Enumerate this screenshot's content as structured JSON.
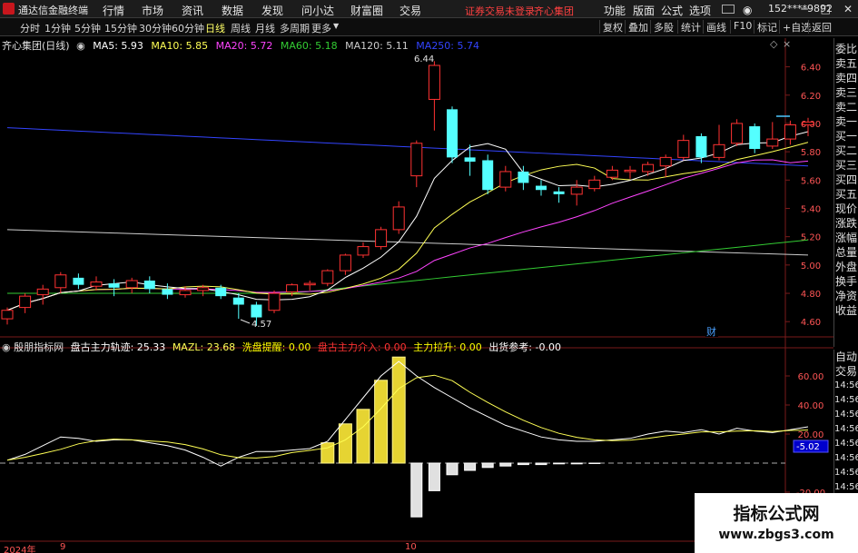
{
  "menubar": {
    "app_title": "通达信金融终端",
    "menus": [
      "行情",
      "市场",
      "资讯",
      "数据",
      "发现",
      "问小达",
      "财富圈",
      "交易"
    ],
    "trade_status": "证券交易未登录",
    "stock_name_red": "齐心集团",
    "right_menus": [
      "功能",
      "版面",
      "公式",
      "选项"
    ],
    "account": "152****9892",
    "window_controls": [
      "─",
      "□",
      "✕"
    ]
  },
  "toolbar": {
    "timeframes": [
      "分时",
      "1分钟",
      "5分钟",
      "15分钟",
      "30分钟",
      "60分钟",
      "日线",
      "周线",
      "月线",
      "多周期",
      "更多"
    ],
    "active_timeframe": "日线",
    "right_buttons": [
      "复权",
      "叠加",
      "多股",
      "统计",
      "画线",
      "F10",
      "标记",
      "+自选",
      "返回"
    ]
  },
  "main_chart": {
    "title": "齐心集团(日线)",
    "ma_labels": [
      {
        "text": "MA5: 5.93",
        "color": "#ffffff"
      },
      {
        "text": "MA10: 5.85",
        "color": "#ffff55"
      },
      {
        "text": "MA20: 5.72",
        "color": "#ff44ff"
      },
      {
        "text": "MA60: 5.18",
        "color": "#33cc33"
      },
      {
        "text": "MA120: 5.11",
        "color": "#cccccc"
      },
      {
        "text": "MA250: 5.74",
        "color": "#3344ff"
      }
    ],
    "high_label": "6.44",
    "low_label": "4.57",
    "cai_label": "财",
    "price_ticks": [
      "6.40",
      "6.20",
      "6.00",
      "5.80",
      "5.60",
      "5.40",
      "5.20",
      "5.00",
      "4.80",
      "4.60"
    ]
  },
  "right_panel": {
    "items": [
      "委比",
      "卖五",
      "卖四",
      "卖三",
      "卖二",
      "卖一",
      "买一",
      "买二",
      "买三",
      "买四",
      "买五",
      "现价",
      "涨跌",
      "涨幅",
      "总量",
      "外盘",
      "换手",
      "净资",
      "收益"
    ],
    "lower_items": [
      "自动",
      "交易",
      "14:56",
      "14:56",
      "14:56",
      "14:56",
      "14:56",
      "14:56",
      "14:56",
      "14:56"
    ]
  },
  "sub_chart": {
    "title": "殷朋指标网",
    "labels": [
      {
        "text": "盘古主力轨迹: 25.33",
        "color": "#ffffff"
      },
      {
        "text": "MAZL: 23.68",
        "color": "#ffff55"
      },
      {
        "text": "洗盘提醒: 0.00",
        "color": "#ffff00"
      },
      {
        "text": "盘古主力介入: 0.00",
        "color": "#ff3333"
      },
      {
        "text": "主力拉升: 0.00",
        "color": "#ffff00"
      },
      {
        "text": "出货参考: -0.00",
        "color": "#ffffff"
      }
    ],
    "ticks": [
      "60.00",
      "40.00",
      "20.00",
      "-20.00",
      "-40.00"
    ],
    "current_value_box": "-5.02"
  },
  "date_axis": {
    "year_label": "2024年",
    "marks": [
      "9",
      "10"
    ]
  },
  "watermark": {
    "line1": "指标公式网",
    "line2": "www.zbgs3.com"
  },
  "chart_data": {
    "type": "candlestick",
    "candles": [
      [
        4.62,
        4.68,
        4.7,
        4.58
      ],
      [
        4.7,
        4.78,
        4.8,
        4.66
      ],
      [
        4.79,
        4.83,
        4.86,
        4.72
      ],
      [
        4.84,
        4.93,
        4.95,
        4.8
      ],
      [
        4.91,
        4.86,
        4.94,
        4.83
      ],
      [
        4.85,
        4.88,
        4.92,
        4.82
      ],
      [
        4.87,
        4.84,
        4.9,
        4.78
      ],
      [
        4.84,
        4.89,
        4.91,
        4.8
      ],
      [
        4.89,
        4.83,
        4.92,
        4.8
      ],
      [
        4.83,
        4.79,
        4.87,
        4.76
      ],
      [
        4.79,
        4.82,
        4.85,
        4.77
      ],
      [
        4.82,
        4.84,
        4.86,
        4.78
      ],
      [
        4.84,
        4.78,
        4.86,
        4.76
      ],
      [
        4.77,
        4.72,
        4.8,
        4.62
      ],
      [
        4.72,
        4.63,
        4.74,
        4.57
      ],
      [
        4.68,
        4.8,
        4.82,
        4.66
      ],
      [
        4.81,
        4.86,
        4.87,
        4.78
      ],
      [
        4.86,
        4.87,
        4.89,
        4.82
      ],
      [
        4.87,
        4.96,
        4.97,
        4.85
      ],
      [
        4.96,
        5.07,
        5.08,
        4.93
      ],
      [
        5.07,
        5.13,
        5.16,
        5.05
      ],
      [
        5.13,
        5.25,
        5.27,
        5.11
      ],
      [
        5.25,
        5.41,
        5.45,
        5.22
      ],
      [
        5.63,
        5.86,
        5.88,
        5.55
      ],
      [
        6.17,
        6.41,
        6.44,
        5.95
      ],
      [
        6.1,
        5.76,
        6.12,
        5.72
      ],
      [
        5.76,
        5.73,
        5.85,
        5.63
      ],
      [
        5.74,
        5.53,
        5.78,
        5.5
      ],
      [
        5.55,
        5.66,
        5.7,
        5.52
      ],
      [
        5.66,
        5.58,
        5.7,
        5.53
      ],
      [
        5.56,
        5.53,
        5.6,
        5.49
      ],
      [
        5.52,
        5.5,
        5.55,
        5.44
      ],
      [
        5.5,
        5.55,
        5.6,
        5.42
      ],
      [
        5.54,
        5.6,
        5.63,
        5.52
      ],
      [
        5.62,
        5.67,
        5.7,
        5.6
      ],
      [
        5.66,
        5.67,
        5.7,
        5.61
      ],
      [
        5.66,
        5.71,
        5.73,
        5.63
      ],
      [
        5.7,
        5.76,
        5.78,
        5.62
      ],
      [
        5.76,
        5.88,
        5.92,
        5.74
      ],
      [
        5.91,
        5.76,
        5.93,
        5.72
      ],
      [
        5.76,
        5.85,
        5.99,
        5.74
      ],
      [
        5.86,
        6.0,
        6.03,
        5.84
      ],
      [
        5.98,
        5.82,
        6.0,
        5.79
      ],
      [
        5.84,
        5.89,
        6.01,
        5.82
      ],
      [
        5.89,
        5.99,
        6.02,
        5.85
      ],
      [
        5.99,
        6.01,
        6.04,
        5.91
      ]
    ],
    "ylim": [
      4.55,
      6.5
    ]
  }
}
